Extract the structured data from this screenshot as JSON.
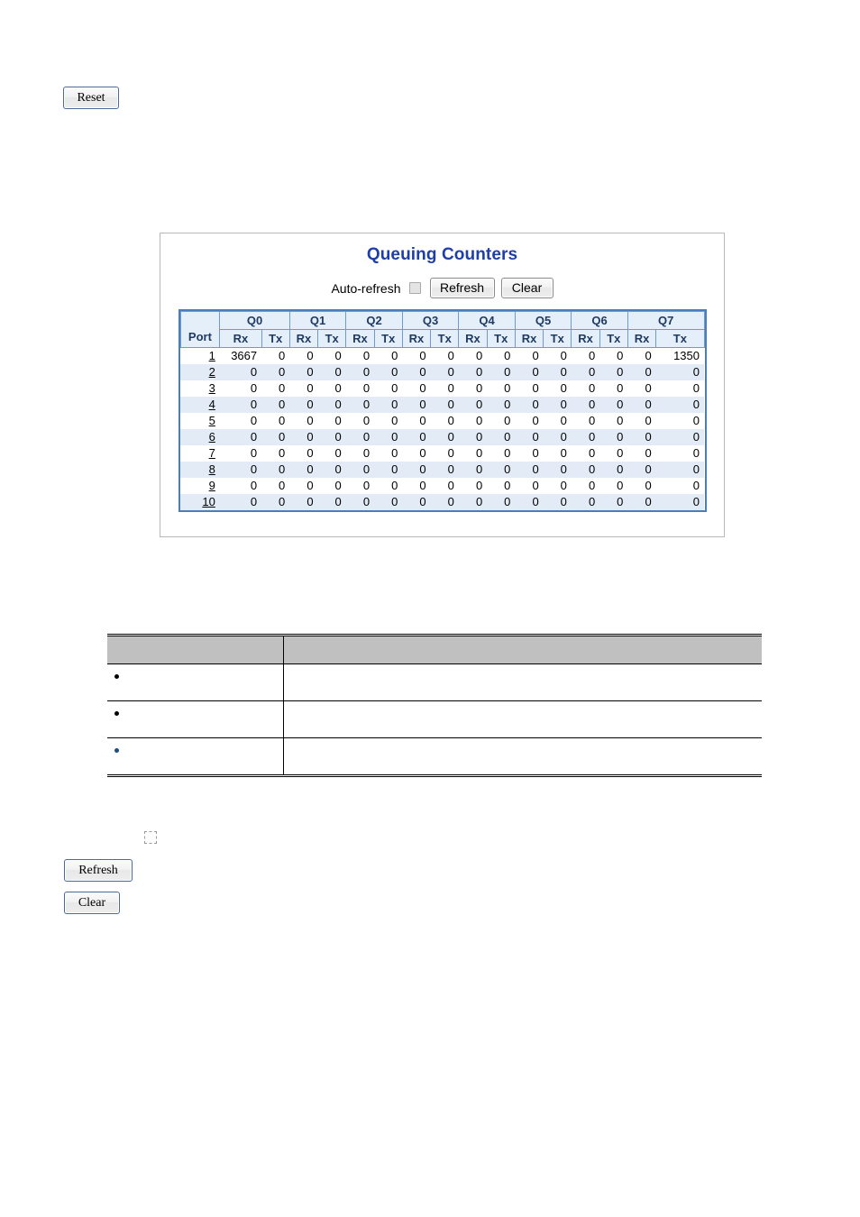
{
  "top": {
    "reset_label": "Reset"
  },
  "panel": {
    "title": "Queuing Counters",
    "toolbar": {
      "auto_refresh_label": "Auto-refresh",
      "auto_refresh_checked": false,
      "refresh_label": "Refresh",
      "clear_label": "Clear"
    },
    "table": {
      "port_header": "Port",
      "queue_headers": [
        "Q0",
        "Q1",
        "Q2",
        "Q3",
        "Q4",
        "Q5",
        "Q6",
        "Q7"
      ],
      "sub_headers": [
        "Rx",
        "Tx"
      ],
      "rows": [
        {
          "port": "1",
          "values": [
            3667,
            0,
            0,
            0,
            0,
            0,
            0,
            0,
            0,
            0,
            0,
            0,
            0,
            0,
            0,
            1350
          ]
        },
        {
          "port": "2",
          "values": [
            0,
            0,
            0,
            0,
            0,
            0,
            0,
            0,
            0,
            0,
            0,
            0,
            0,
            0,
            0,
            0
          ]
        },
        {
          "port": "3",
          "values": [
            0,
            0,
            0,
            0,
            0,
            0,
            0,
            0,
            0,
            0,
            0,
            0,
            0,
            0,
            0,
            0
          ]
        },
        {
          "port": "4",
          "values": [
            0,
            0,
            0,
            0,
            0,
            0,
            0,
            0,
            0,
            0,
            0,
            0,
            0,
            0,
            0,
            0
          ]
        },
        {
          "port": "5",
          "values": [
            0,
            0,
            0,
            0,
            0,
            0,
            0,
            0,
            0,
            0,
            0,
            0,
            0,
            0,
            0,
            0
          ]
        },
        {
          "port": "6",
          "values": [
            0,
            0,
            0,
            0,
            0,
            0,
            0,
            0,
            0,
            0,
            0,
            0,
            0,
            0,
            0,
            0
          ]
        },
        {
          "port": "7",
          "values": [
            0,
            0,
            0,
            0,
            0,
            0,
            0,
            0,
            0,
            0,
            0,
            0,
            0,
            0,
            0,
            0
          ]
        },
        {
          "port": "8",
          "values": [
            0,
            0,
            0,
            0,
            0,
            0,
            0,
            0,
            0,
            0,
            0,
            0,
            0,
            0,
            0,
            0
          ]
        },
        {
          "port": "9",
          "values": [
            0,
            0,
            0,
            0,
            0,
            0,
            0,
            0,
            0,
            0,
            0,
            0,
            0,
            0,
            0,
            0
          ]
        },
        {
          "port": "10",
          "values": [
            0,
            0,
            0,
            0,
            0,
            0,
            0,
            0,
            0,
            0,
            0,
            0,
            0,
            0,
            0,
            0
          ]
        }
      ]
    }
  },
  "description_table": {
    "headers": [
      "",
      ""
    ],
    "rows": [
      {
        "term": "",
        "description": "",
        "bullet": "black"
      },
      {
        "term": "",
        "description": "",
        "bullet": "black"
      },
      {
        "term": "",
        "description": "",
        "bullet": "blue"
      }
    ]
  },
  "bottom": {
    "checkbox_checked": false,
    "refresh_label": "Refresh",
    "clear_label": "Clear"
  },
  "colors": {
    "title_blue": "#1f3fa8",
    "table_border_blue": "#4a7ebb",
    "header_fill": "#e5eff9",
    "row_stripe": "#e3ecf6",
    "desc_header_gray": "#c0c0c0",
    "bullet_blue": "#1f4e79"
  }
}
